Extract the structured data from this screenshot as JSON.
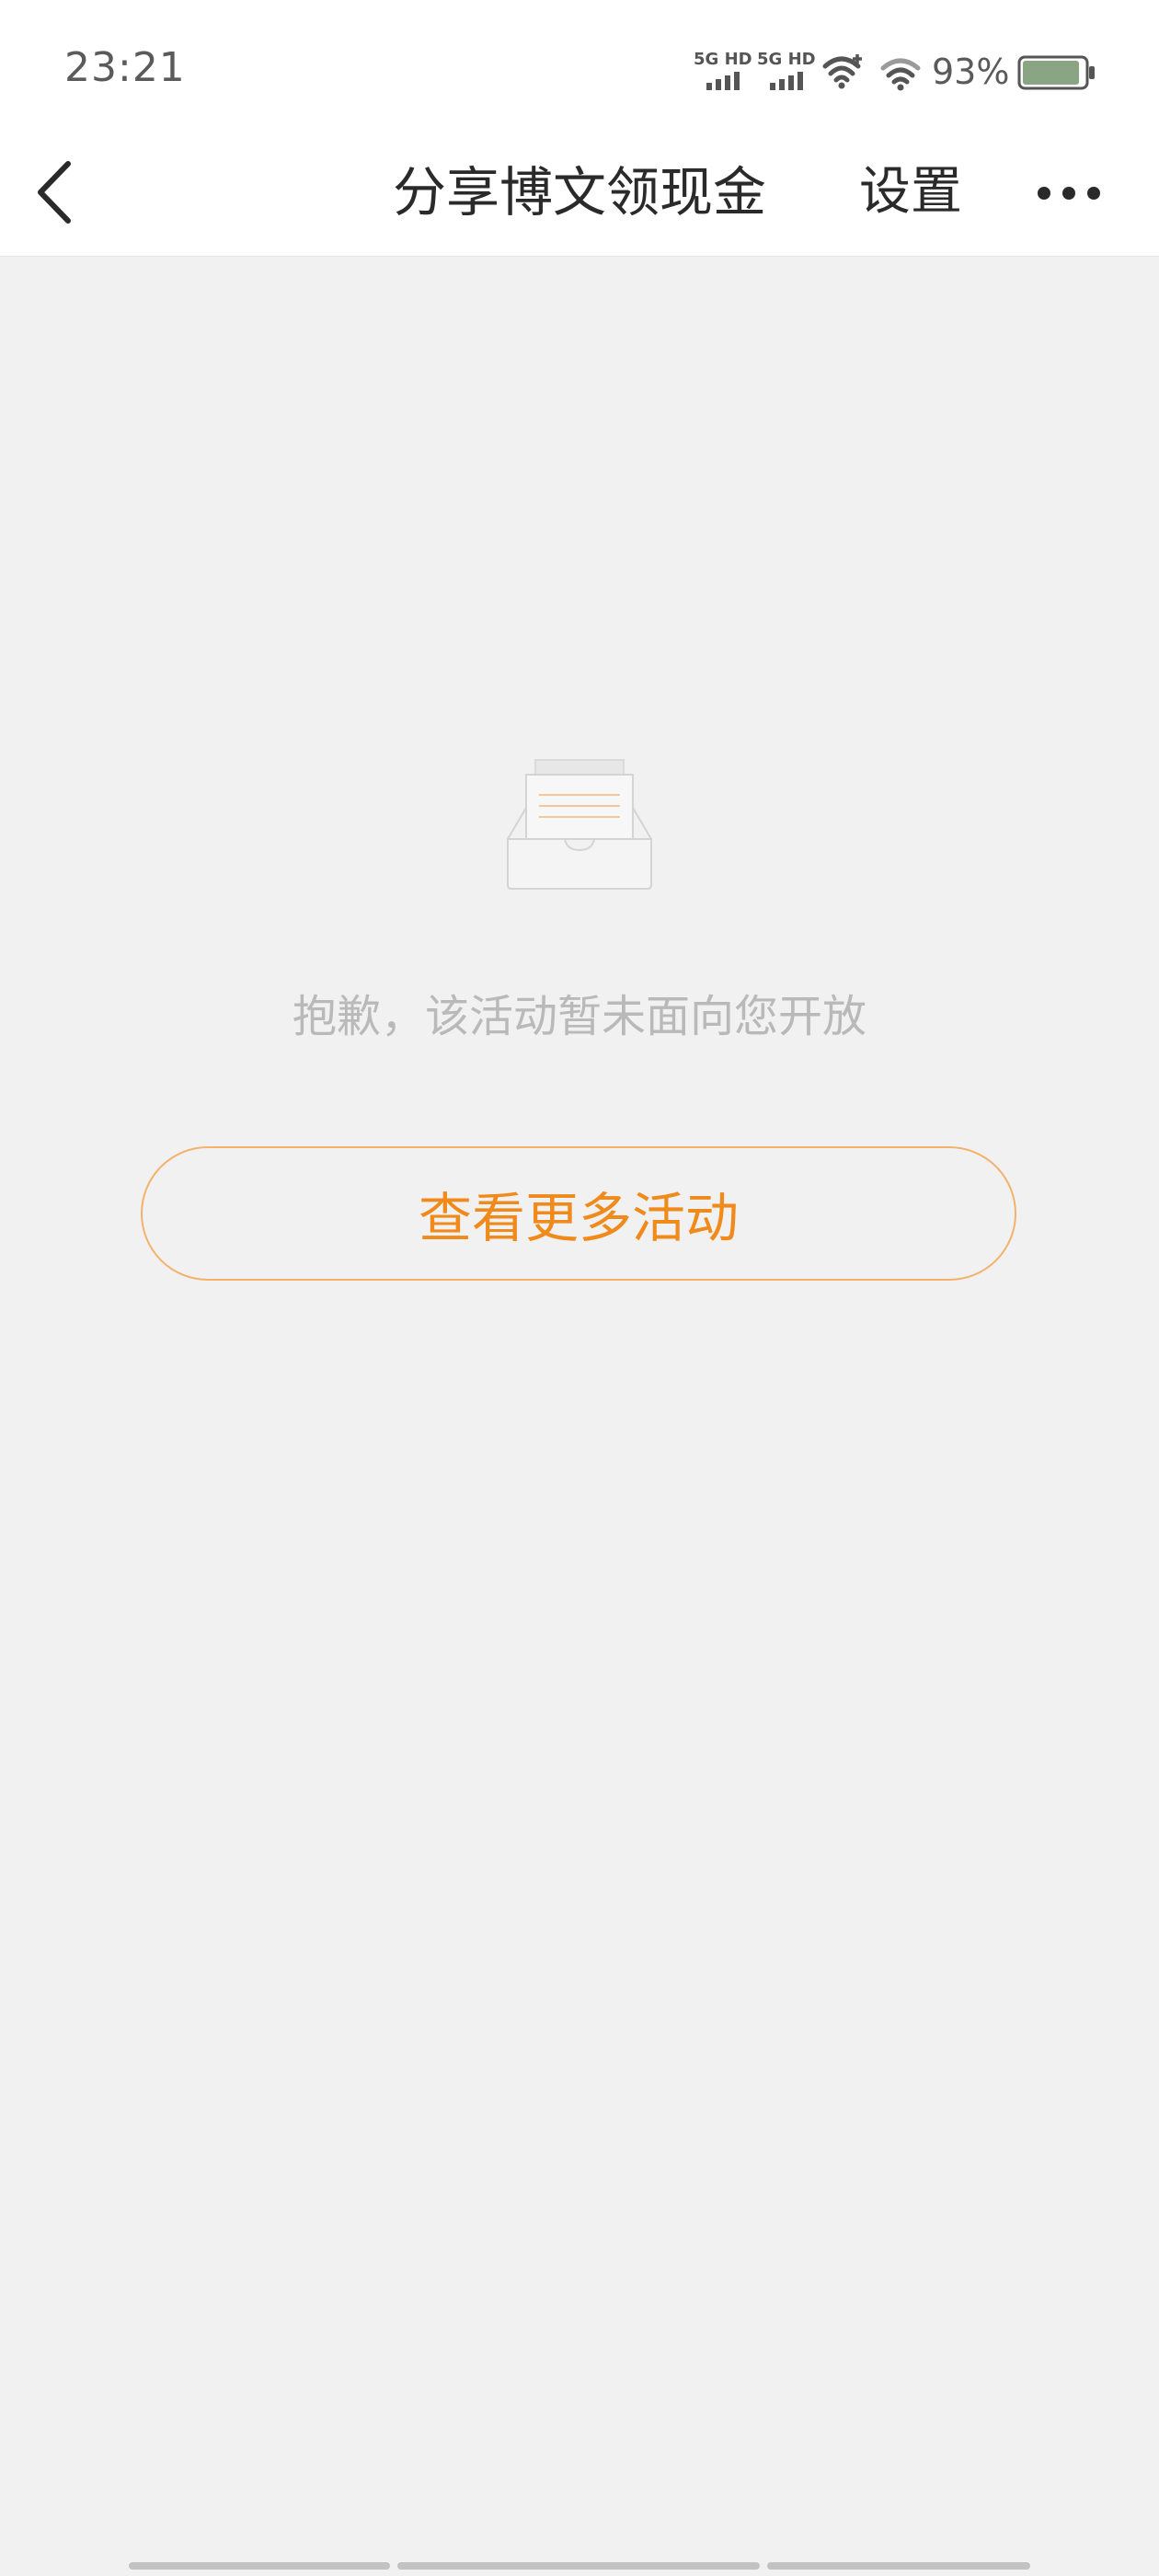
{
  "status_bar": {
    "time": "23:21",
    "signal_1_label": "5G HD",
    "signal_2_label": "5G HD",
    "battery_percent": "93%",
    "battery_level": 0.93,
    "icons": [
      "signal-icon",
      "signal-icon",
      "wifi-plus-icon",
      "wifi-icon",
      "battery-icon"
    ]
  },
  "nav": {
    "back_icon": "chevron-left-icon",
    "title": "分享博文领现金",
    "settings_label": "设置",
    "more_icon": "more-dots-icon"
  },
  "empty_state": {
    "illustration_icon": "empty-inbox-icon",
    "message": "抱歉，该活动暂未面向您开放",
    "button_label": "查看更多活动"
  },
  "colors": {
    "accent": "#ef8a1b",
    "button_border": "#f2b26b",
    "background": "#f1f1f1",
    "message_text": "#b9b9b9"
  }
}
